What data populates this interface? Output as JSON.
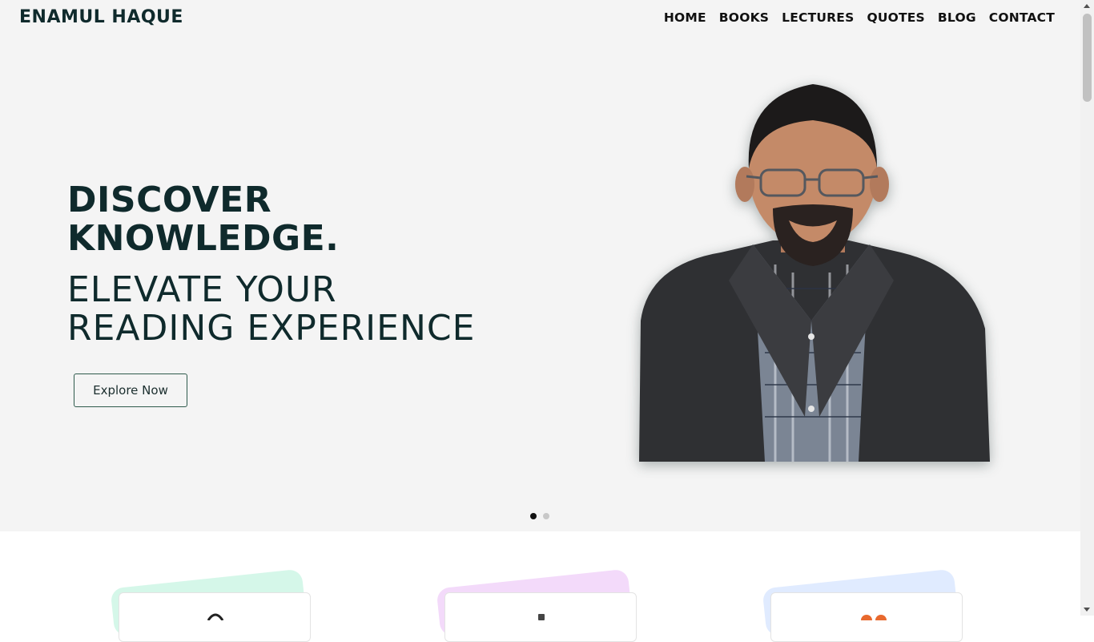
{
  "brand": "ENAMUL HAQUE",
  "nav": {
    "items": [
      "HOME",
      "BOOKS",
      "LECTURES",
      "QUOTES",
      "BLOG",
      "CONTACT"
    ]
  },
  "hero": {
    "headline_line1": "DISCOVER",
    "headline_line2": "KNOWLEDGE.",
    "subhead_line1": "ELEVATE YOUR",
    "subhead_line2": "READING EXPERIENCE",
    "cta_label": "Explore Now",
    "slider": {
      "slide_count": 2,
      "active_index": 0
    }
  },
  "colors": {
    "hero_bg": "#f4f4f4",
    "heading": "#0f2a2c",
    "cta_border": "#2e5a4c",
    "feature_blob_1": "#bff3dd",
    "feature_blob_2": "#ecc6f7",
    "feature_blob_3": "#cfe0ff"
  },
  "features": [
    {
      "icon": "user-icon"
    },
    {
      "icon": "phone-icon"
    },
    {
      "icon": "people-icon"
    }
  ]
}
